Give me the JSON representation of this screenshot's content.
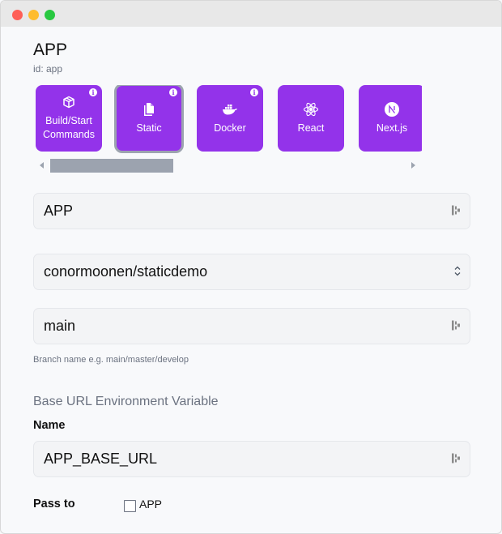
{
  "window": {
    "controls": [
      "close",
      "minimize",
      "zoom"
    ]
  },
  "app": {
    "title": "APP",
    "id_label": "id: app"
  },
  "deploy_types": [
    {
      "label": "Build/Start Commands",
      "icon": "cube-icon",
      "info": true,
      "selected": false
    },
    {
      "label": "Static",
      "icon": "document-icon",
      "info": true,
      "selected": true
    },
    {
      "label": "Docker",
      "icon": "docker-icon",
      "info": true,
      "selected": false
    },
    {
      "label": "React",
      "icon": "react-icon",
      "info": false,
      "selected": false
    },
    {
      "label": "Next.js",
      "icon": "nextjs-icon",
      "info": false,
      "selected": false
    }
  ],
  "info_glyph": "i",
  "form": {
    "name_value": "APP",
    "repo_value": "conormoonen/staticdemo",
    "branch_value": "main",
    "branch_helper": "Branch name e.g. main/master/develop",
    "env_section_title": "Base URL Environment Variable",
    "env_name_label": "Name",
    "env_name_value": "APP_BASE_URL",
    "pass_to_label": "Pass to",
    "pass_to_options": [
      {
        "label": "APP",
        "checked": false
      }
    ]
  },
  "colors": {
    "accent": "#9333ea",
    "selected_outline": "#9ca3af"
  }
}
